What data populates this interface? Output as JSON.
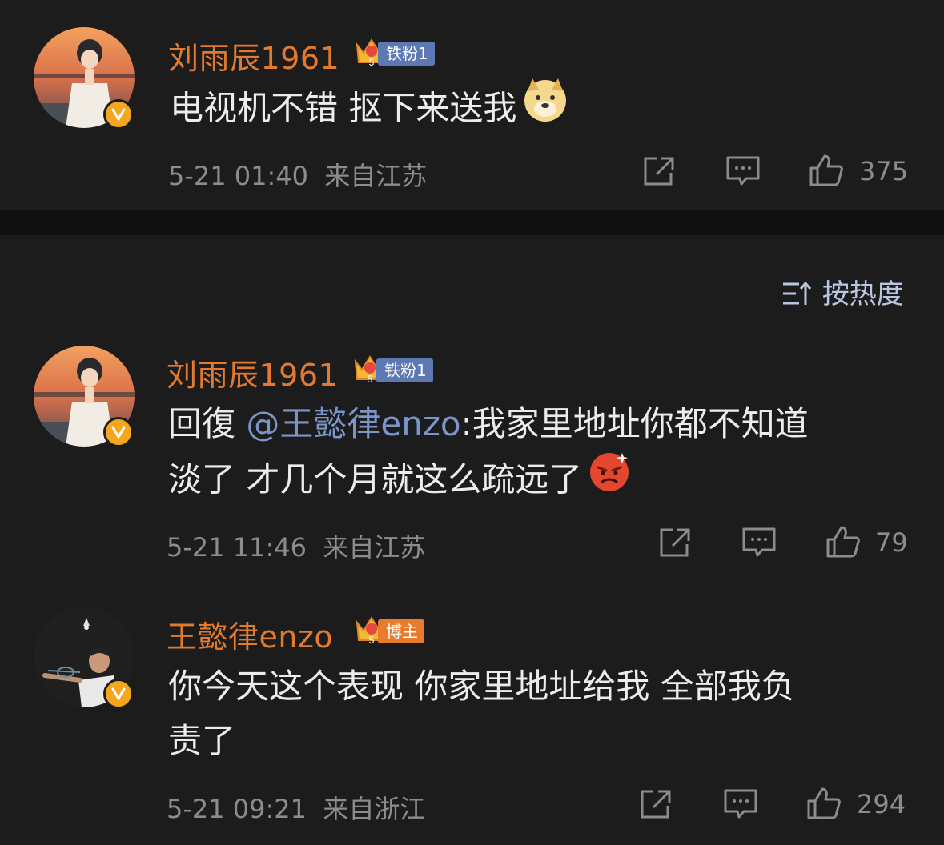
{
  "comments": [
    {
      "user": "刘雨辰1961",
      "badge": "铁粉1",
      "text": "电视机不错 抠下来送我",
      "time": "5-21 01:40",
      "location": "来自江苏",
      "likes": "375",
      "emoji": "doge-emoji"
    }
  ],
  "sort_label": "按热度",
  "replies": [
    {
      "user": "刘雨辰1961",
      "badge": "铁粉1",
      "prefix": "回復 ",
      "mention": "@王懿律enzo",
      "text_line1": ":我家里地址你都不知道",
      "text_line2": "淡了 才几个月就这么疏远了",
      "time": "5-21 11:46",
      "location": "来自江苏",
      "likes": "79",
      "emoji": "angry-emoji"
    },
    {
      "user": "王懿律enzo",
      "badge": "博主",
      "text_line1": "你今天这个表现 你家里地址给我 全部我负",
      "text_line2": "责了",
      "time": "5-21 09:21",
      "location": "来自浙江",
      "likes": "294"
    }
  ],
  "colors": {
    "background": "#1c1c1c",
    "username": "#e47a2f",
    "mention": "#7b95c9",
    "meta": "#8c8c8c",
    "fan_badge": "#5c79b3",
    "blogger_badge": "#e77c2c",
    "verified": "#f4a61d"
  }
}
